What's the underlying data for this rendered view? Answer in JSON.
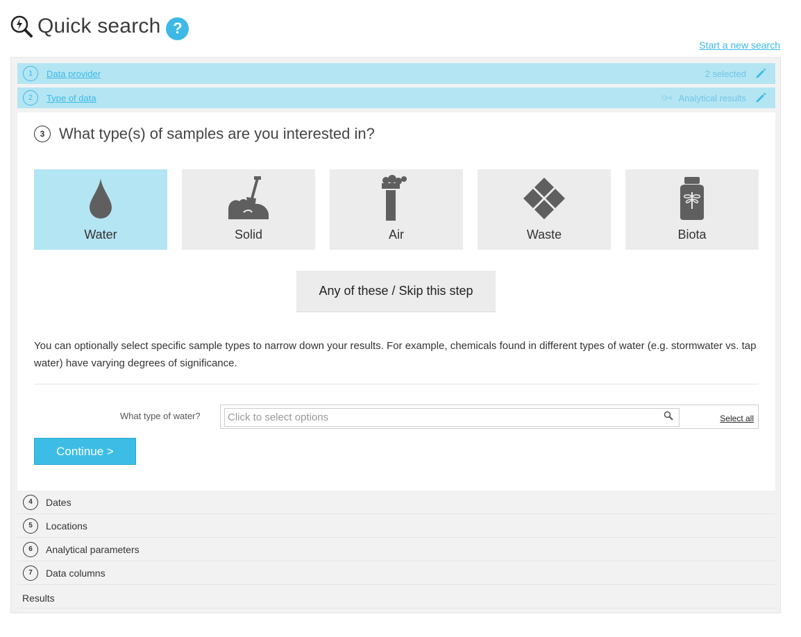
{
  "header": {
    "title": "Quick search",
    "help_label": "?",
    "logo_icon": "quick-search-magnifier-icon",
    "new_search_link": "Start a new search"
  },
  "completed_steps": [
    {
      "number": "1",
      "label": "Data provider",
      "summary": "2 selected"
    },
    {
      "number": "2",
      "label": "Type of data",
      "summary": "Analytical results"
    }
  ],
  "active_step": {
    "number": "3",
    "question": "What type(s) of samples are you interested in?",
    "sample_types": [
      {
        "label": "Water",
        "icon": "water-drop-icon",
        "selected": true
      },
      {
        "label": "Solid",
        "icon": "soil-shovel-icon",
        "selected": false
      },
      {
        "label": "Air",
        "icon": "chimney-smoke-icon",
        "selected": false
      },
      {
        "label": "Waste",
        "icon": "waste-diamond-icon",
        "selected": false
      },
      {
        "label": "Biota",
        "icon": "dragonfly-jar-icon",
        "selected": false
      }
    ],
    "skip_label": "Any of these / Skip this step",
    "info_text": "You can optionally select specific sample types to narrow down your results. For example, chemicals found in different types of water (e.g. stormwater vs. tap water) have varying degrees of significance.",
    "water_field": {
      "label": "What type of water?",
      "placeholder": "Click to select options",
      "select_all": "Select all"
    },
    "continue_label": "Continue >"
  },
  "future_steps": [
    {
      "number": "4",
      "label": "Dates"
    },
    {
      "number": "5",
      "label": "Locations"
    },
    {
      "number": "6",
      "label": "Analytical parameters"
    },
    {
      "number": "7",
      "label": "Data columns"
    }
  ],
  "results_label": "Results",
  "colors": {
    "accent": "#3db9e5",
    "completed_bg": "#b4e5f3",
    "tile_bg": "#ececec",
    "icon_gray": "#5f5f5f"
  }
}
